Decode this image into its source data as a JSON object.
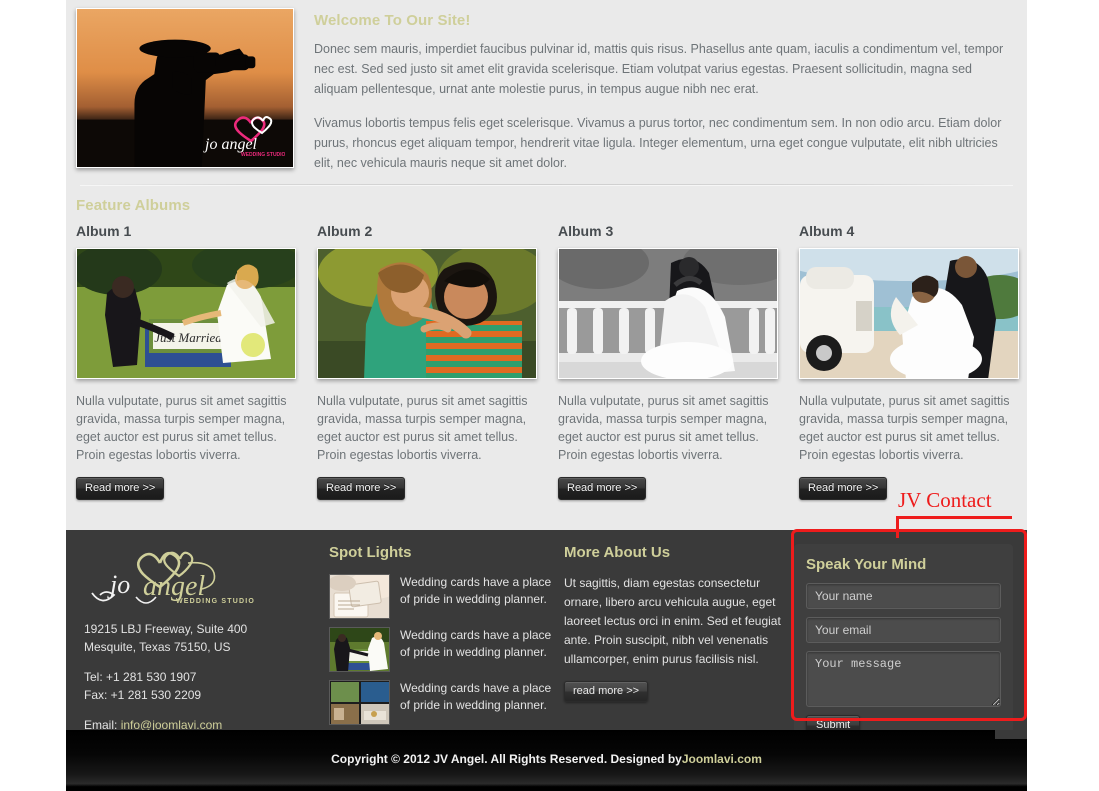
{
  "welcome": {
    "title": "Welcome To Our Site!",
    "paragraphs": [
      "Donec sem mauris, imperdiet faucibus pulvinar id, mattis quis risus. Phasellus ante quam, iaculis a condimentum vel, tempor nec est. Sed sed justo sit amet elit gravida scelerisque. Etiam volutpat varius egestas. Praesent sollicitudin, magna sed aliquam pellentesque, urnat ante molestie purus, in tempus augue nibh nec erat.",
      "Vivamus lobortis tempus felis eget scelerisque. Vivamus a purus tortor, nec condimentum sem. In non odio arcu. Etiam dolor purus, rhoncus eget aliquam tempor, hendrerit vitae ligula. Integer elementum, urna eget congue vulputate, elit nibh ultricies elit, nec vehicula mauris neque sit amet dolor."
    ],
    "photo_watermark": "jo angel WEDDING STUDIO"
  },
  "albums": {
    "section_title": "Feature Albums",
    "items": [
      {
        "title": "Album 1",
        "text": "Nulla vulputate, purus sit amet sagittis gravida, massa turpis semper magna, eget auctor est purus sit amet tellus. Proin egestas lobortis viverra.",
        "button": "Read more >>"
      },
      {
        "title": "Album 2",
        "text": "Nulla vulputate, purus sit amet sagittis gravida, massa turpis semper magna, eget auctor est purus sit amet tellus. Proin egestas lobortis viverra.",
        "button": "Read more >>"
      },
      {
        "title": "Album 3",
        "text": "Nulla vulputate, purus sit amet sagittis gravida, massa turpis semper magna, eget auctor est purus sit amet tellus. Proin egestas lobortis viverra.",
        "button": "Read more >>"
      },
      {
        "title": "Album 4",
        "text": "Nulla vulputate, purus sit amet sagittis gravida, massa turpis semper magna, eget auctor est purus sit amet tellus. Proin egestas lobortis viverra.",
        "button": "Read more >>"
      }
    ]
  },
  "footer": {
    "logo_text": "jo angel",
    "logo_sub": "WEDDING STUDIO",
    "address_line1": "19215 LBJ Freeway, Suite 400",
    "address_line2": "Mesquite, Texas 75150, US",
    "tel": "Tel: +1 281 530 1907",
    "fax": "Fax: +1 281 530 2209",
    "email_label": "Email: ",
    "email": "info@joomlavi.com",
    "spotlights": {
      "title": "Spot Lights",
      "items": [
        {
          "text": "Wedding cards have a place of pride in wedding planner."
        },
        {
          "text": "Wedding cards have a place of pride in wedding planner."
        },
        {
          "text": "Wedding cards have a place of pride in wedding planner."
        }
      ]
    },
    "about": {
      "title": "More About Us",
      "text": "Ut sagittis, diam egestas consectetur ornare, libero arcu vehicula augue, eget laoreet lectus orci in enim. Sed et feugiat ante. Proin suscipit, nibh vel venenatis ullamcorper, enim purus facilisis nisl.",
      "button": "read more >>"
    },
    "contact": {
      "title": "Speak Your Mind",
      "name_placeholder": "Your name",
      "name_value": "",
      "email_placeholder": "Your email",
      "email_value": "",
      "message_placeholder": "Your message",
      "message_value": "",
      "submit_label": "Submit"
    }
  },
  "copyright": {
    "text": "Copyright © 2012 JV Angel. All Rights Reserved. Designed by ",
    "link": "Joomlavi.com"
  },
  "annotation": {
    "label": "JV Contact",
    "color": "#ee1c1c"
  },
  "colors": {
    "page_bg": "#eaeaea",
    "footer_bg": "#3a3a3a",
    "heading_accent": "#cfcf9a",
    "body_text": "#6e7478"
  }
}
